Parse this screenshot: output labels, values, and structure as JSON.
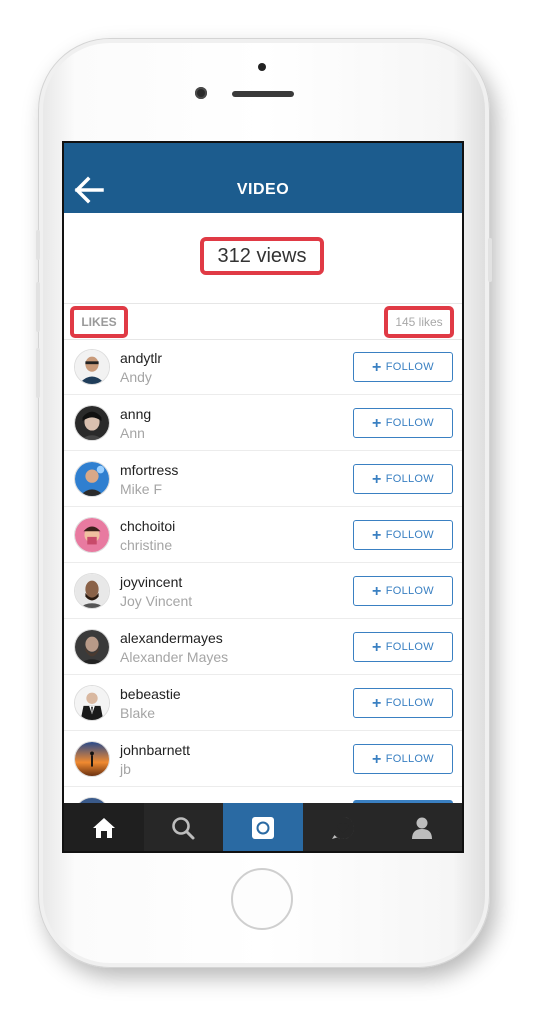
{
  "header": {
    "title": "VIDEO",
    "back_icon": "back-arrow-icon"
  },
  "stats": {
    "views": "312 views",
    "likes_label": "LIKES",
    "likes_count": "145 likes"
  },
  "colors": {
    "nav_blue": "#1c5c8e",
    "follow_blue": "#3a80c2",
    "highlight_red": "#e03a45",
    "tabbar": "#272727",
    "tab_active": "#2a6aa3"
  },
  "follow_label": "FOLLOW",
  "users": [
    {
      "username": "andytlr",
      "name": "Andy"
    },
    {
      "username": "anng",
      "name": "Ann"
    },
    {
      "username": "mfortress",
      "name": "Mike F"
    },
    {
      "username": "chchoitoi",
      "name": "christine"
    },
    {
      "username": "joyvincent",
      "name": "Joy Vincent"
    },
    {
      "username": "alexandermayes",
      "name": "Alexander Mayes"
    },
    {
      "username": "bebeastie",
      "name": "Blake"
    },
    {
      "username": "johnbarnett",
      "name": "jb"
    }
  ],
  "tabs": [
    {
      "icon": "home-icon"
    },
    {
      "icon": "search-icon"
    },
    {
      "icon": "camera-icon"
    },
    {
      "icon": "activity-heart-icon"
    },
    {
      "icon": "profile-icon"
    }
  ]
}
